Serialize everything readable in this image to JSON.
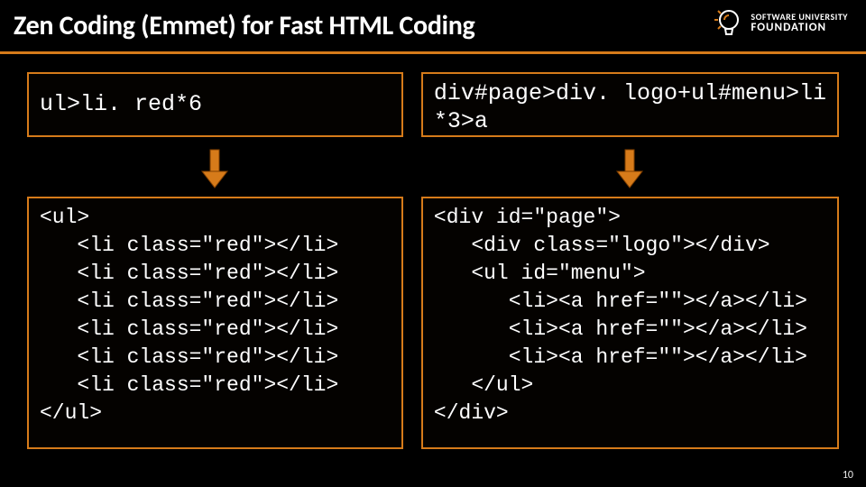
{
  "title": "Zen Coding (Emmet) for Fast HTML Coding",
  "logo": {
    "line1": "SOFTWARE UNIVERSITY",
    "line2": "FOUNDATION"
  },
  "left": {
    "snippet": "ul>li. red*6",
    "output": "<ul>\n   <li class=\"red\"></li>\n   <li class=\"red\"></li>\n   <li class=\"red\"></li>\n   <li class=\"red\"></li>\n   <li class=\"red\"></li>\n   <li class=\"red\"></li>\n</ul>"
  },
  "right": {
    "snippet": "div#page>div. logo+ul#menu>li\n*3>a",
    "output": "<div id=\"page\">\n   <div class=\"logo\"></div>\n   <ul id=\"menu\">\n      <li><a href=\"\"></a></li>\n      <li><a href=\"\"></a></li>\n      <li><a href=\"\"></a></li>\n   </ul>\n</div>"
  },
  "pageNumber": "10"
}
